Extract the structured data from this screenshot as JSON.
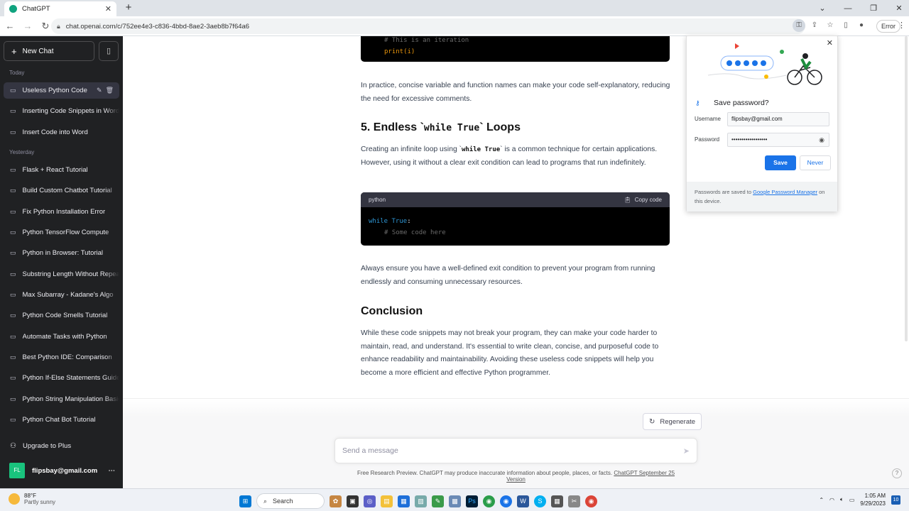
{
  "browser": {
    "tab_title": "ChatGPT",
    "url": "chat.openai.com/c/752ee4e3-c836-4bbd-8ae2-3aeb8b7f64a6",
    "error_label": "Error"
  },
  "sidebar": {
    "new_chat": "New Chat",
    "today_label": "Today",
    "yesterday_label": "Yesterday",
    "today_items": [
      {
        "label": "Useless Python Code"
      },
      {
        "label": "Inserting Code Snippets in Word"
      },
      {
        "label": "Insert Code into Word"
      }
    ],
    "yesterday_items": [
      {
        "label": "Flask + React Tutorial"
      },
      {
        "label": "Build Custom Chatbot Tutorial"
      },
      {
        "label": "Fix Python Installation Error"
      },
      {
        "label": "Python TensorFlow Compute"
      },
      {
        "label": "Python in Browser: Tutorial"
      },
      {
        "label": "Substring Length Without Repeat"
      },
      {
        "label": "Max Subarray - Kadane's Algo"
      },
      {
        "label": "Python Code Smells Tutorial"
      },
      {
        "label": "Automate Tasks with Python"
      },
      {
        "label": "Best Python IDE: Comparison"
      },
      {
        "label": "Python If-Else Statements Guide"
      },
      {
        "label": "Python String Manipulation Basics"
      },
      {
        "label": "Python Chat Bot Tutorial"
      }
    ],
    "upgrade": "Upgrade to Plus",
    "user_initials": "FL",
    "user_email": "flipsbay@gmail.com"
  },
  "content": {
    "top_code_comment": "# This is an iteration",
    "top_code_line": "print(i)",
    "para1": "In practice, concise variable and function names can make your code self-explanatory, reducing the need for excessive comments.",
    "h_loops_prefix": "5. Endless `",
    "h_loops_code": "while True",
    "h_loops_suffix": "` Loops",
    "para2_a": "Creating an infinite loop using `",
    "para2_code": "while True",
    "para2_b": "` is a common technique for certain applications. However, using it without a clear exit condition can lead to programs that run indefinitely.",
    "code_lang": "python",
    "copy_code": "Copy code",
    "code_kw": "while",
    "code_true": "True",
    "code_line1_end": ":",
    "code_comment": "# Some code here",
    "para3": "Always ensure you have a well-defined exit condition to prevent your program from running endlessly and consuming unnecessary resources.",
    "h_conclusion": "Conclusion",
    "para4": "While these code snippets may not break your program, they can make your code harder to maintain, read, and understand. It's essential to write clean, concise, and purposeful code to enhance readability and maintainability. Avoiding these useless code snippets will help you become a more efficient and effective Python programmer."
  },
  "composer": {
    "regenerate": "Regenerate",
    "placeholder": "Send a message",
    "disclaimer": "Free Research Preview. ChatGPT may produce inaccurate information about people, places, or facts.",
    "version_link": "ChatGPT September 25 Version",
    "help": "?"
  },
  "password_popup": {
    "title": "Save password?",
    "username_label": "Username",
    "username_value": "flipsbay@gmail.com",
    "password_label": "Password",
    "password_value": "••••••••••••••••••",
    "save": "Save",
    "never": "Never",
    "footer_a": "Passwords are saved to ",
    "footer_link": "Google Password Manager",
    "footer_b": " on this device."
  },
  "taskbar": {
    "temperature": "88°F",
    "weather": "Partly sunny",
    "search": "Search",
    "time": "1:05 AM",
    "date": "9/29/2023",
    "notifications": "10"
  }
}
